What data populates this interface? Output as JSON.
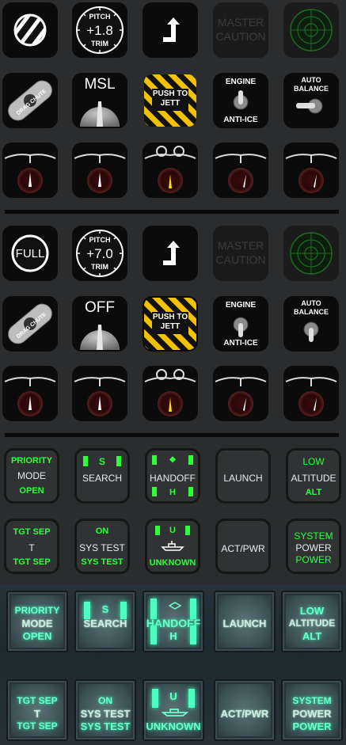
{
  "pitch_trim": {
    "top": "PITCH",
    "bottom": "TRIM"
  },
  "panel1": {
    "pitch_value": "+1.8",
    "altitude_knob_label": "MSL",
    "jett_line1": "PUSH TO",
    "jett_line2": "JETT",
    "master_caution_line1": "MASTER",
    "master_caution_line2": "CAUTION",
    "engine_top": "ENGINE",
    "engine_bottom": "ANTI-ICE",
    "auto_balance_top": "AUTO",
    "auto_balance_bottom": "BALANCE",
    "drag_chute_text": "DRAG CHUTE"
  },
  "panel2": {
    "full_label": "FULL",
    "pitch_value": "+7.0",
    "altitude_knob_label": "OFF",
    "jett_line1": "PUSH TO",
    "jett_line2": "JETT",
    "master_caution_line1": "MASTER",
    "master_caution_line2": "CAUTION",
    "engine_top": "ENGINE",
    "engine_bottom": "ANTI-ICE",
    "auto_balance_top": "AUTO",
    "auto_balance_bottom": "BALANCE",
    "drag_chute_text": "DRAG CHUTE"
  },
  "rwr": {
    "priority": {
      "top": "PRIORITY",
      "mid": "MODE",
      "bottom": "OPEN"
    },
    "search": {
      "top": "S",
      "mid": "SEARCH"
    },
    "handoff": {
      "top": "◆",
      "mid": "HANDOFF",
      "bottom": "H"
    },
    "launch": {
      "mid": "LAUNCH"
    },
    "altitude": {
      "top": "LOW",
      "mid": "ALTITUDE",
      "bottom": "ALT"
    },
    "tgtsep": {
      "top": "TGT SEP",
      "mid": "T",
      "bottom": "TGT SEP"
    },
    "systest": {
      "top": "ON",
      "mid": "SYS TEST",
      "bottom": "SYS TEST"
    },
    "unknown": {
      "top": "U",
      "bottom": "UNKNOWN"
    },
    "actpwr": {
      "mid": "ACT/PWR"
    },
    "power": {
      "top": "SYSTEM",
      "mid": "POWER",
      "bottom": "POWER"
    }
  },
  "lit": {
    "priority": {
      "top": "PRIORITY",
      "mid": "MODE",
      "bottom": "OPEN"
    },
    "search": {
      "top": "S",
      "mid": "SEARCH"
    },
    "handoff": {
      "mid": "HANDOFF",
      "bottom": "H"
    },
    "launch": {
      "mid": "LAUNCH"
    },
    "altitude": {
      "top": "LOW",
      "mid": "ALTITUDE",
      "bottom": "ALT"
    },
    "tgtsep": {
      "top": "TGT SEP",
      "mid": "T",
      "bottom": "TGT SEP"
    },
    "systest": {
      "top": "ON",
      "mid": "SYS TEST",
      "bottom": "SYS TEST"
    },
    "unknown": {
      "top": "U",
      "bottom": "UNKNOWN"
    },
    "actpwr": {
      "mid": "ACT/PWR"
    },
    "power": {
      "top": "SYSTEM",
      "mid": "POWER",
      "bottom": "POWER"
    }
  },
  "colors": {
    "amber": "#f2c200",
    "green_on": "#2bff3a",
    "lit_green": "#6dffc9",
    "dim_text": "#3a3a3a"
  }
}
